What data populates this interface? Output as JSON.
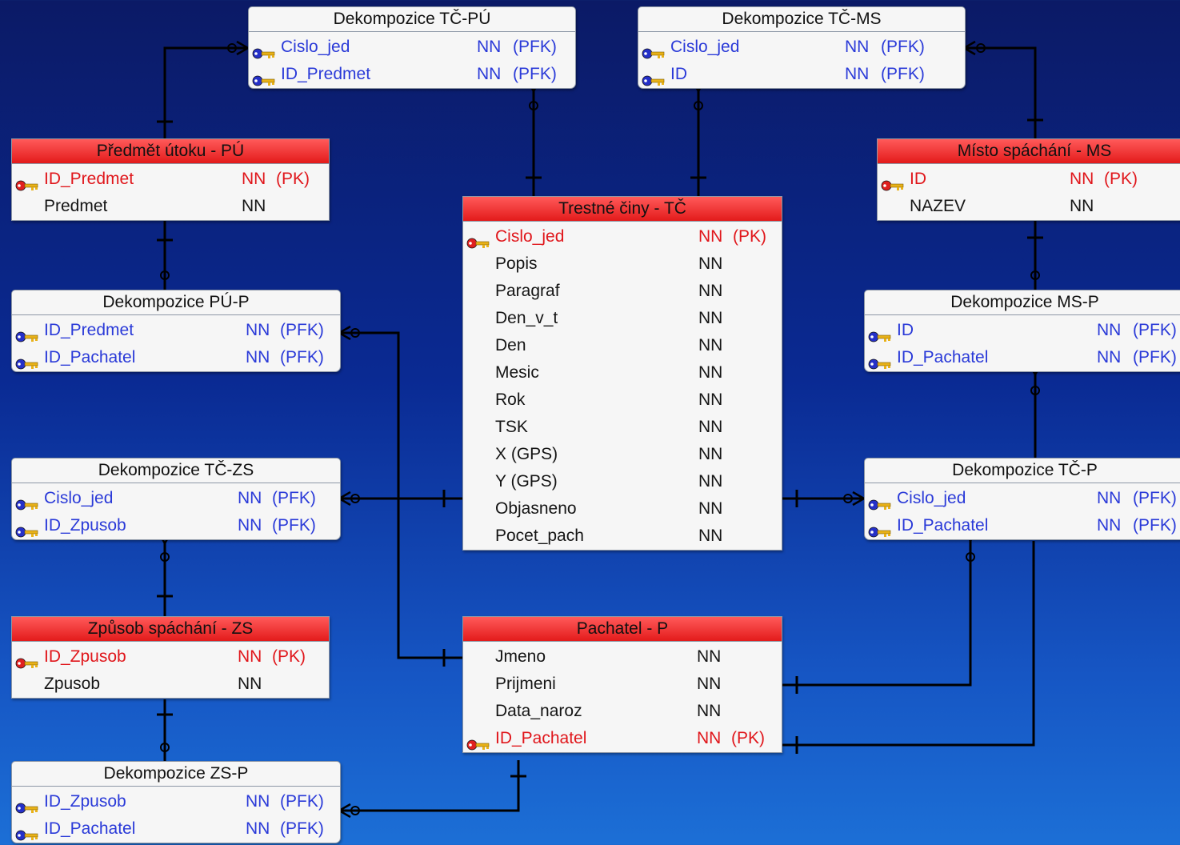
{
  "colors": {
    "background_top": "#0b1a66",
    "background_bottom": "#1c6fd6",
    "entity_header": "#e31b1b",
    "decomposition_header": "#b8c6e0",
    "primary_key_text": "#e0161b",
    "foreign_key_text": "#2a3ad8",
    "relationship_line": "#000000"
  },
  "tables": [
    {
      "id": "dek-tc-pu",
      "title": "Dekompozice TČ-PÚ",
      "kind": "decomposition",
      "rows": [
        {
          "name": "Cislo_jed",
          "nn": "NN",
          "key": "(PFK)",
          "icon": "foreign-key-icon"
        },
        {
          "name": "ID_Predmet",
          "nn": "NN",
          "key": "(PFK)",
          "icon": "foreign-key-icon"
        }
      ]
    },
    {
      "id": "dek-tc-ms",
      "title": "Dekompozice TČ-MS",
      "kind": "decomposition",
      "rows": [
        {
          "name": "Cislo_jed",
          "nn": "NN",
          "key": "(PFK)",
          "icon": "foreign-key-icon"
        },
        {
          "name": "ID",
          "nn": "NN",
          "key": "(PFK)",
          "icon": "foreign-key-icon"
        }
      ]
    },
    {
      "id": "predmet-utoku",
      "title": "Předmět útoku - PÚ",
      "kind": "entity",
      "rows": [
        {
          "name": "ID_Predmet",
          "nn": "NN",
          "key": "(PK)",
          "icon": "primary-key-icon"
        },
        {
          "name": "Predmet",
          "nn": "NN",
          "key": "",
          "icon": ""
        }
      ]
    },
    {
      "id": "misto-spachani",
      "title": "Místo spáchání - MS",
      "kind": "entity",
      "rows": [
        {
          "name": "ID",
          "nn": "NN",
          "key": "(PK)",
          "icon": "primary-key-icon"
        },
        {
          "name": "NAZEV",
          "nn": "NN",
          "key": "",
          "icon": ""
        }
      ]
    },
    {
      "id": "trestne-ciny",
      "title": "Trestné činy - TČ",
      "kind": "entity",
      "rows": [
        {
          "name": "Cislo_jed",
          "nn": "NN",
          "key": "(PK)",
          "icon": "primary-key-icon"
        },
        {
          "name": "Popis",
          "nn": "NN",
          "key": "",
          "icon": ""
        },
        {
          "name": "Paragraf",
          "nn": "NN",
          "key": "",
          "icon": ""
        },
        {
          "name": "Den_v_t",
          "nn": "NN",
          "key": "",
          "icon": ""
        },
        {
          "name": "Den",
          "nn": "NN",
          "key": "",
          "icon": ""
        },
        {
          "name": "Mesic",
          "nn": "NN",
          "key": "",
          "icon": ""
        },
        {
          "name": "Rok",
          "nn": "NN",
          "key": "",
          "icon": ""
        },
        {
          "name": "TSK",
          "nn": "NN",
          "key": "",
          "icon": ""
        },
        {
          "name": "X (GPS)",
          "nn": "NN",
          "key": "",
          "icon": ""
        },
        {
          "name": "Y (GPS)",
          "nn": "NN",
          "key": "",
          "icon": ""
        },
        {
          "name": "Objasneno",
          "nn": "NN",
          "key": "",
          "icon": ""
        },
        {
          "name": "Pocet_pach",
          "nn": "NN",
          "key": "",
          "icon": ""
        }
      ]
    },
    {
      "id": "dek-pu-p",
      "title": "Dekompozice PÚ-P",
      "kind": "decomposition",
      "rows": [
        {
          "name": "ID_Predmet",
          "nn": "NN",
          "key": "(PFK)",
          "icon": "foreign-key-icon"
        },
        {
          "name": "ID_Pachatel",
          "nn": "NN",
          "key": "(PFK)",
          "icon": "foreign-key-icon"
        }
      ]
    },
    {
      "id": "dek-ms-p",
      "title": "Dekompozice MS-P",
      "kind": "decomposition",
      "rows": [
        {
          "name": "ID",
          "nn": "NN",
          "key": "(PFK)",
          "icon": "foreign-key-icon"
        },
        {
          "name": "ID_Pachatel",
          "nn": "NN",
          "key": "(PFK)",
          "icon": "foreign-key-icon"
        }
      ]
    },
    {
      "id": "dek-tc-zs",
      "title": "Dekompozice TČ-ZS",
      "kind": "decomposition",
      "rows": [
        {
          "name": "Cislo_jed",
          "nn": "NN",
          "key": "(PFK)",
          "icon": "foreign-key-icon"
        },
        {
          "name": "ID_Zpusob",
          "nn": "NN",
          "key": "(PFK)",
          "icon": "foreign-key-icon"
        }
      ]
    },
    {
      "id": "dek-tc-p",
      "title": "Dekompozice TČ-P",
      "kind": "decomposition",
      "rows": [
        {
          "name": "Cislo_jed",
          "nn": "NN",
          "key": "(PFK)",
          "icon": "foreign-key-icon"
        },
        {
          "name": "ID_Pachatel",
          "nn": "NN",
          "key": "(PFK)",
          "icon": "foreign-key-icon"
        }
      ]
    },
    {
      "id": "zpusob-spachani",
      "title": "Způsob spáchání - ZS",
      "kind": "entity",
      "rows": [
        {
          "name": "ID_Zpusob",
          "nn": "NN",
          "key": "(PK)",
          "icon": "primary-key-icon"
        },
        {
          "name": "Zpusob",
          "nn": "NN",
          "key": "",
          "icon": ""
        }
      ]
    },
    {
      "id": "pachatel",
      "title": "Pachatel - P",
      "kind": "entity",
      "rows": [
        {
          "name": "Jmeno",
          "nn": "NN",
          "key": "",
          "icon": ""
        },
        {
          "name": "Prijmeni",
          "nn": "NN",
          "key": "",
          "icon": ""
        },
        {
          "name": "Data_naroz",
          "nn": "NN",
          "key": "",
          "icon": ""
        },
        {
          "name": "ID_Pachatel",
          "nn": "NN",
          "key": "(PK)",
          "icon": "primary-key-icon"
        }
      ]
    },
    {
      "id": "dek-zs-p",
      "title": "Dekompozice ZS-P",
      "kind": "decomposition",
      "rows": [
        {
          "name": "ID_Zpusob",
          "nn": "NN",
          "key": "(PFK)",
          "icon": "foreign-key-icon"
        },
        {
          "name": "ID_Pachatel",
          "nn": "NN",
          "key": "(PFK)",
          "icon": "foreign-key-icon"
        }
      ]
    }
  ],
  "relationships": [
    {
      "from": "predmet-utoku",
      "to": "dek-tc-pu"
    },
    {
      "from": "trestne-ciny",
      "to": "dek-tc-pu"
    },
    {
      "from": "trestne-ciny",
      "to": "dek-tc-ms"
    },
    {
      "from": "misto-spachani",
      "to": "dek-tc-ms"
    },
    {
      "from": "predmet-utoku",
      "to": "dek-pu-p"
    },
    {
      "from": "misto-spachani",
      "to": "dek-ms-p"
    },
    {
      "from": "trestne-ciny",
      "to": "dek-tc-zs"
    },
    {
      "from": "zpusob-spachani",
      "to": "dek-tc-zs"
    },
    {
      "from": "trestne-ciny",
      "to": "dek-tc-p"
    },
    {
      "from": "zpusob-spachani",
      "to": "dek-zs-p"
    },
    {
      "from": "pachatel",
      "to": "dek-pu-p"
    },
    {
      "from": "pachatel",
      "to": "dek-tc-p"
    },
    {
      "from": "pachatel",
      "to": "dek-ms-p"
    },
    {
      "from": "pachatel",
      "to": "dek-zs-p"
    }
  ]
}
